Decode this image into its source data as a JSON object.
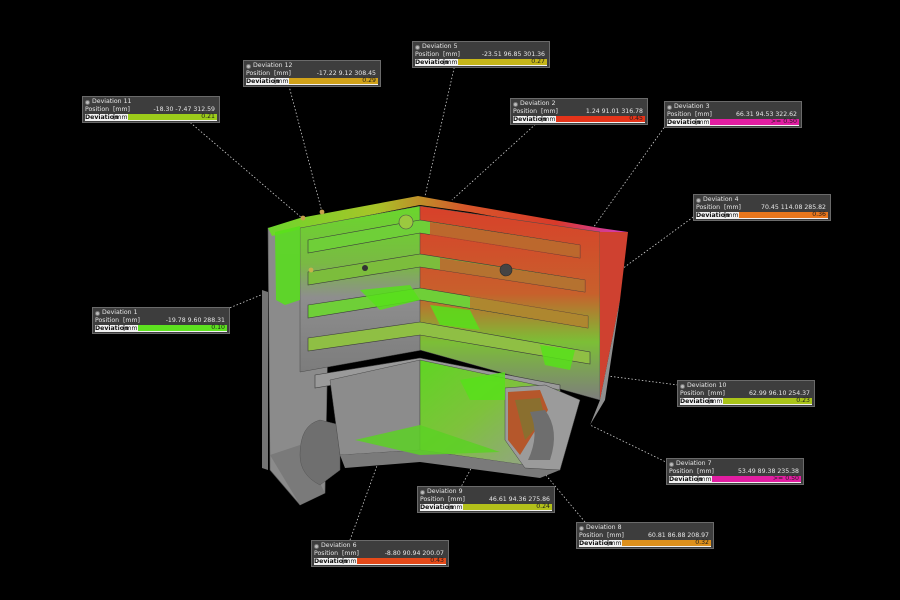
{
  "app": {
    "view": "deviation-analysis-3d"
  },
  "labels": {
    "position": "Position",
    "deviation": "Deviation",
    "unit": "[mm]"
  },
  "colors": {
    "background": "#000000",
    "part": "#9a9a9a",
    "green": "#5fe21f",
    "red": "#e0361a",
    "orange": "#e7871c",
    "magenta": "#e01ca0",
    "yellowgreen": "#b7c61a"
  },
  "callouts": [
    {
      "id": 1,
      "title": "Deviation 1",
      "position": "-19.78  9.60  288.31",
      "deviation": "0.10",
      "color": "#5de11f"
    },
    {
      "id": 2,
      "title": "Deviation 2",
      "position": "1.24  91.01  316.78",
      "deviation": "0.45",
      "color": "#e5341a"
    },
    {
      "id": 3,
      "title": "Deviation 3",
      "position": "66.31  94.53  322.62",
      "deviation": ">= 0.50",
      "color": "#e21ea2"
    },
    {
      "id": 4,
      "title": "Deviation 4",
      "position": "70.45  114.08  285.82",
      "deviation": "0.36",
      "color": "#e8761c"
    },
    {
      "id": 5,
      "title": "Deviation 5",
      "position": "-23.51  96.85  301.36",
      "deviation": "0.27",
      "color": "#c6b61a"
    },
    {
      "id": 6,
      "title": "Deviation 6",
      "position": "-8.80  90.94  200.07",
      "deviation": "0.43",
      "color": "#e54a1a"
    },
    {
      "id": 7,
      "title": "Deviation 7",
      "position": "53.49  89.38  235.38",
      "deviation": ">= 0.50",
      "color": "#e21ea2"
    },
    {
      "id": 8,
      "title": "Deviation 8",
      "position": "60.81  86.88  208.97",
      "deviation": "0.32",
      "color": "#dd901c"
    },
    {
      "id": 9,
      "title": "Deviation 9",
      "position": "46.61  94.36  275.86",
      "deviation": "0.24",
      "color": "#b3c01a"
    },
    {
      "id": 10,
      "title": "Deviation 10",
      "position": "62.99  96.10  254.37",
      "deviation": "0.23",
      "color": "#aac41a"
    },
    {
      "id": 11,
      "title": "Deviation 11",
      "position": "-18.30  -7.47  312.59",
      "deviation": "0.21",
      "color": "#9ccc1a"
    },
    {
      "id": 12,
      "title": "Deviation 12",
      "position": "-17.22  9.12  308.45",
      "deviation": "0.29",
      "color": "#d1a21a"
    }
  ]
}
